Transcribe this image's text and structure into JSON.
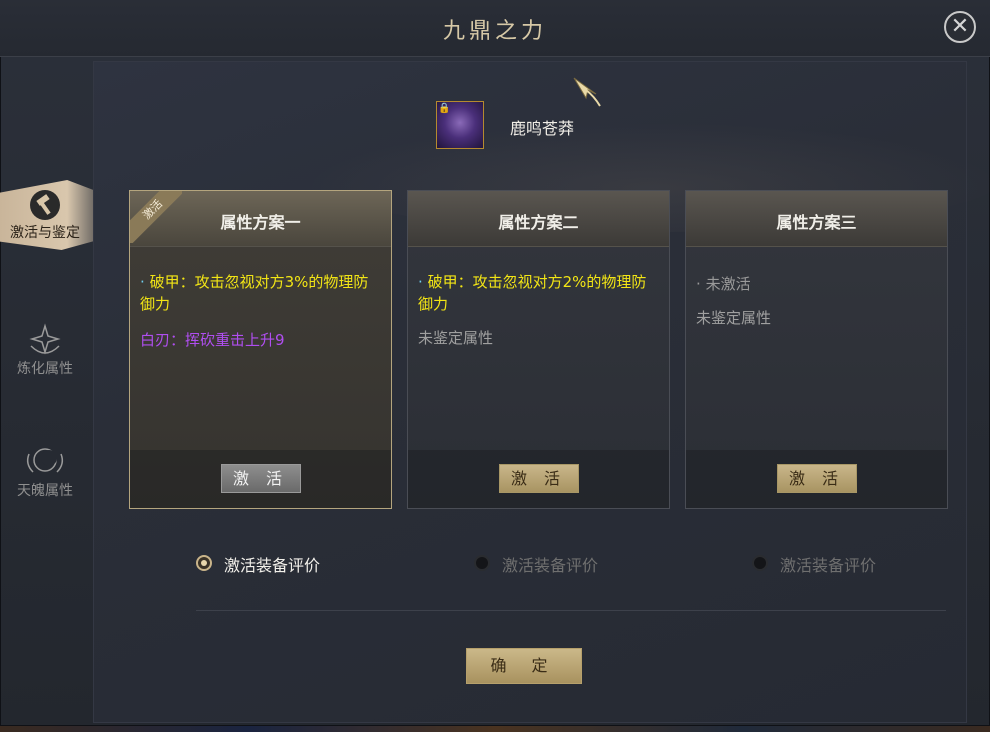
{
  "window": {
    "title": "九鼎之力"
  },
  "side_tabs": [
    {
      "label": "激活与鉴定",
      "icon": "hammer-icon",
      "active": true
    },
    {
      "label": "炼化属性",
      "icon": "star-icon",
      "active": false
    },
    {
      "label": "天魄属性",
      "icon": "crescent-icon",
      "active": false
    }
  ],
  "item": {
    "name": "鹿鸣苍莽",
    "icon": "purple-gem-icon"
  },
  "cards": [
    {
      "title": "属性方案一",
      "badge": "激活",
      "lines": [
        {
          "text": "破甲：攻击忽视对方3%的物理防御力",
          "color": "#f2e515",
          "dot": "·"
        },
        {
          "text": "白刃：挥砍重击上升9",
          "color": "#b04ef0"
        }
      ],
      "button": "激 活"
    },
    {
      "title": "属性方案二",
      "lines": [
        {
          "text": "破甲：攻击忽视对方2%的物理防御力",
          "color": "#f2e515",
          "dot": "·"
        },
        {
          "text": "未鉴定属性",
          "color": "#a0a0a0"
        }
      ],
      "button": "激 活"
    },
    {
      "title": "属性方案三",
      "lines": [
        {
          "text": "未激活",
          "color": "#9a9a9a",
          "dot": "·"
        },
        {
          "text": "未鉴定属性",
          "color": "#a0a0a0"
        }
      ],
      "button": "激 活"
    }
  ],
  "radios": [
    {
      "label": "激活装备评价",
      "selected": true
    },
    {
      "label": "激活装备评价",
      "selected": false
    },
    {
      "label": "激活装备评价",
      "selected": false
    }
  ],
  "confirm_button": "确 定",
  "close_icon": "close-icon"
}
